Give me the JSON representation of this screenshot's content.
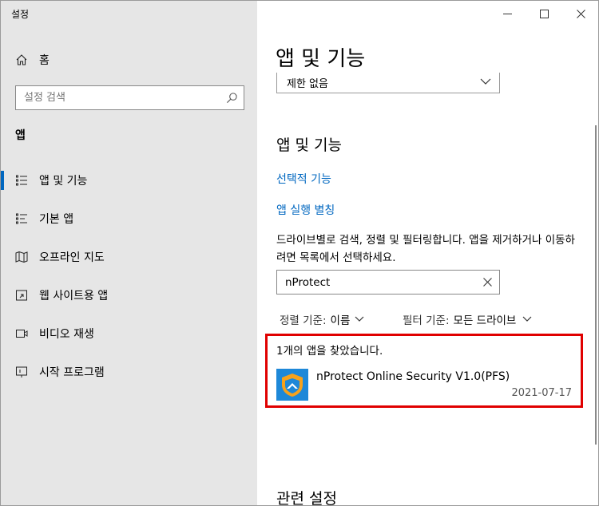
{
  "window": {
    "title": "설정",
    "controls": [
      "minimize",
      "maximize",
      "close"
    ]
  },
  "sidebar": {
    "home_label": "홈",
    "search_placeholder": "설정 검색",
    "section_header": "앱",
    "items": [
      {
        "label": "앱 및 기능",
        "icon": "apps-features-icon",
        "active": true
      },
      {
        "label": "기본 앱",
        "icon": "default-apps-icon",
        "active": false
      },
      {
        "label": "오프라인 지도",
        "icon": "offline-maps-icon",
        "active": false
      },
      {
        "label": "웹 사이트용 앱",
        "icon": "apps-for-websites-icon",
        "active": false
      },
      {
        "label": "비디오 재생",
        "icon": "video-playback-icon",
        "active": false
      },
      {
        "label": "시작 프로그램",
        "icon": "startup-icon",
        "active": false
      }
    ]
  },
  "main": {
    "page_title": "앱 및 기능",
    "filter_dropdown_value": "제한 없음",
    "sub_title": "앱 및 기능",
    "link_optional_features": "선택적 기능",
    "link_app_execution_aliases": "앱 실행 별칭",
    "description": "드라이브별로 검색, 정렬 및 필터링합니다. 앱을 제거하거나 이동하려면 목록에서 선택하세요.",
    "search_value": "nProtect",
    "sort_label": "정렬 기준:",
    "sort_value": "이름",
    "filter_label": "필터 기준:",
    "filter_value": "모든 드라이브",
    "result_count_text": "1개의 앱을 찾았습니다.",
    "apps": [
      {
        "name": "nProtect Online Security V1.0(PFS)",
        "date": "2021-07-17",
        "icon": "nprotect-app-icon"
      }
    ],
    "related_settings_title": "관련 설정"
  },
  "colors": {
    "sidebar_bg": "#e6e6e6",
    "accent": "#0067c0",
    "highlight_border": "#e00000",
    "app_icon_bg": "#1e88d8",
    "app_icon_accent": "#f7a21b"
  }
}
